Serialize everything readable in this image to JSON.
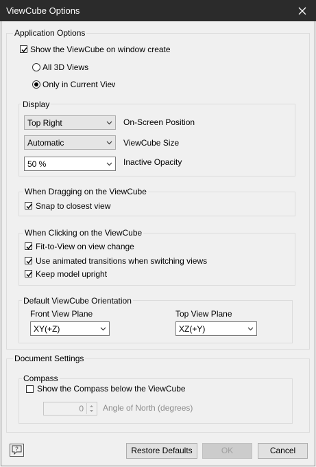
{
  "window": {
    "title": "ViewCube Options"
  },
  "app_options": {
    "label": "Application Options",
    "show_viewcube": "Show the ViewCube on window create",
    "radio_all": "All 3D Views",
    "radio_current": "Only in Current View"
  },
  "display": {
    "label": "Display",
    "position_value": "Top Right",
    "position_label": "On-Screen Position",
    "size_value": "Automatic",
    "size_label": "ViewCube Size",
    "opacity_value": "50 %",
    "opacity_label": "Inactive Opacity"
  },
  "dragging": {
    "label": "When Dragging on the ViewCube",
    "snap": "Snap to closest view"
  },
  "clicking": {
    "label": "When Clicking on the ViewCube",
    "fit": "Fit-to-View on view change",
    "animated": "Use animated transitions when switching views",
    "upright": "Keep model upright"
  },
  "orientation": {
    "label": "Default ViewCube Orientation",
    "front_label": "Front View Plane",
    "front_value": "XY(+Z)",
    "top_label": "Top View Plane",
    "top_value": "XZ(+Y)"
  },
  "document": {
    "label": "Document Settings",
    "compass_label": "Compass",
    "show_compass": "Show the Compass below the ViewCube",
    "angle_value": "0",
    "angle_label": "Angle of North (degrees)"
  },
  "buttons": {
    "restore": "Restore Defaults",
    "ok": "OK",
    "cancel": "Cancel"
  },
  "icons": {
    "help": "help-icon",
    "close": "close-icon"
  }
}
